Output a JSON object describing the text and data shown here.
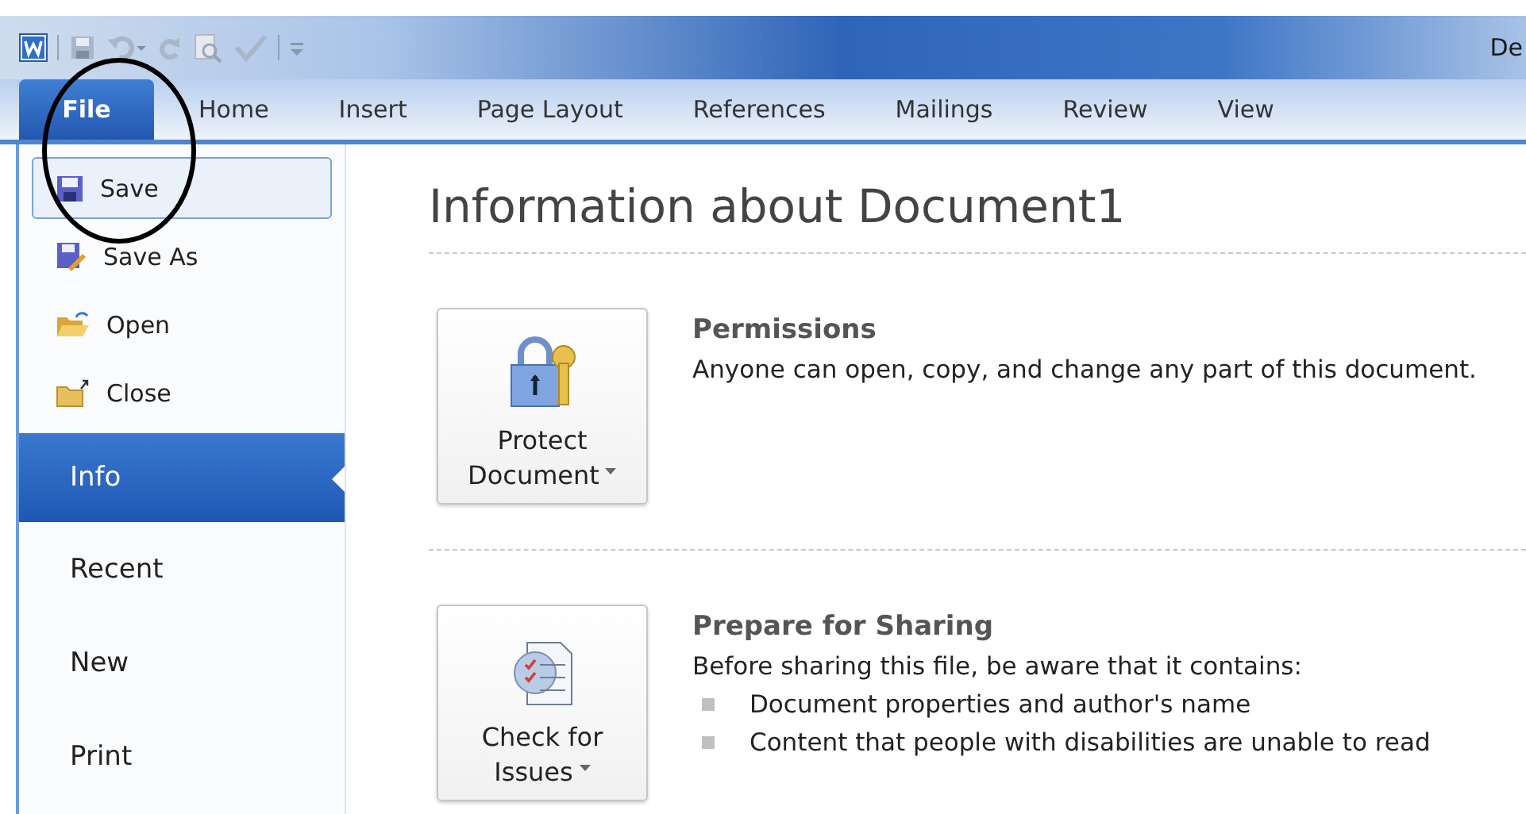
{
  "window": {
    "title": "De"
  },
  "tabs": [
    {
      "label": "File",
      "selected": true
    },
    {
      "label": "Home",
      "selected": false
    },
    {
      "label": "Insert",
      "selected": false
    },
    {
      "label": "Page Layout",
      "selected": false
    },
    {
      "label": "References",
      "selected": false
    },
    {
      "label": "Mailings",
      "selected": false
    },
    {
      "label": "Review",
      "selected": false
    },
    {
      "label": "View",
      "selected": false
    }
  ],
  "sidebar": {
    "commands": [
      {
        "label": "Save",
        "kind": "save",
        "highlighted": true
      },
      {
        "label": "Save As",
        "kind": "saveas",
        "highlighted": false
      },
      {
        "label": "Open",
        "kind": "open",
        "highlighted": false
      },
      {
        "label": "Close",
        "kind": "close",
        "highlighted": false
      }
    ],
    "sections": [
      {
        "label": "Info",
        "selected": true
      },
      {
        "label": "Recent",
        "selected": false
      },
      {
        "label": "New",
        "selected": false
      },
      {
        "label": "Print",
        "selected": false
      }
    ]
  },
  "heading": "Information about Document1",
  "blocks": [
    {
      "button": [
        "Protect",
        "Document"
      ],
      "kind": "lock",
      "title": "Permissions",
      "text": "Anyone can open, copy, and change any part of this document."
    },
    {
      "button": [
        "Check for",
        "Issues"
      ],
      "kind": "check",
      "title": "Prepare for Sharing",
      "text": "Before sharing this file, be aware that it contains:",
      "bullets": [
        "Document properties and author's name",
        "Content that people with disabilities are unable to read"
      ]
    }
  ]
}
